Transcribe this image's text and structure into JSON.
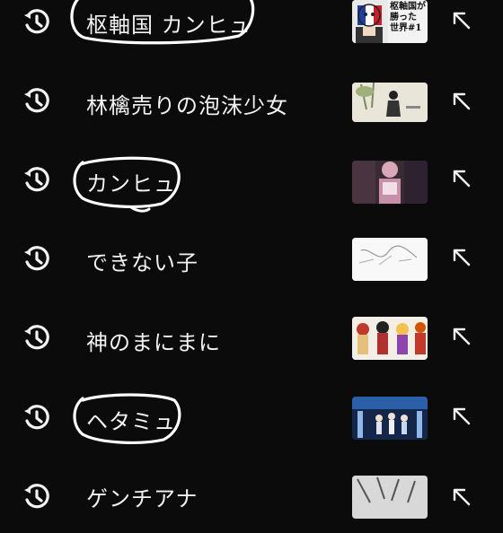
{
  "history": {
    "items": [
      {
        "label": "枢軸国 カンヒュ",
        "icon": "history-icon",
        "action_icon": "insert-query-arrow-icon",
        "thumb_text": [
          "枢軸国が",
          "勝った",
          "世界#1"
        ],
        "circled": true
      },
      {
        "label": "林檎売りの泡沫少女",
        "icon": "history-icon",
        "action_icon": "insert-query-arrow-icon",
        "circled": false
      },
      {
        "label": "カンヒュ",
        "icon": "history-icon",
        "action_icon": "insert-query-arrow-icon",
        "circled": true
      },
      {
        "label": "できない子",
        "icon": "history-icon",
        "action_icon": "insert-query-arrow-icon",
        "circled": false
      },
      {
        "label": "神のまにまに",
        "icon": "history-icon",
        "action_icon": "insert-query-arrow-icon",
        "circled": false
      },
      {
        "label": "ヘタミュ",
        "icon": "history-icon",
        "action_icon": "insert-query-arrow-icon",
        "circled": true
      },
      {
        "label": "ゲンチアナ",
        "icon": "history-icon",
        "action_icon": "insert-query-arrow-icon",
        "circled": false
      }
    ]
  },
  "colors": {
    "background": "#0b0b0b",
    "text": "#f2f2f2",
    "annotation": "#ffffff"
  }
}
